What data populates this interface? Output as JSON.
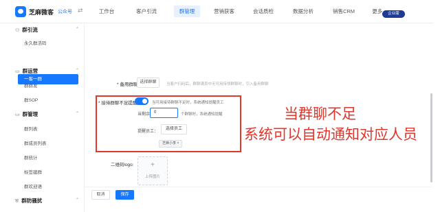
{
  "header": {
    "brand": "芝麻微客",
    "scope": "公众号",
    "nav": [
      "工作台",
      "客户引流",
      "群管理",
      "营销获客",
      "会话质检",
      "数据分析",
      "销售CRM",
      "更多 ⌄"
    ],
    "active_nav": 2,
    "upgrade": "企业版"
  },
  "sidebar": {
    "groups": [
      {
        "label": "群引流",
        "icon": "user-group-icon"
      },
      {
        "label": "群运营",
        "icon": "chat-icon"
      },
      {
        "label": "群管理",
        "icon": "chat-icon"
      },
      {
        "label": "群防骚扰",
        "icon": "shield-icon"
      }
    ],
    "items_g1": [
      "永久群活码"
    ],
    "active_item": "一客一群",
    "items_g2": [
      "群群发",
      "群SOP"
    ],
    "items_g3": [
      "群列表",
      "群成员列表",
      "群统计",
      "标签建群",
      "群欢迎语"
    ]
  },
  "form": {
    "backup_label": "* 备用群聊",
    "backup_button": "选择群聊",
    "backup_hint": "当客户扫码后，群聊满员中无可用待领群聊时，引入备用群聊",
    "remind_label": "* 接待群聊不足提醒",
    "remind_desc": "当可用接待群聊不足时，系统通知提醒员工",
    "cond_prefix": "当剩余",
    "cond_value": "0",
    "cond_suffix": "个群聊时，系统通知提醒",
    "staff_label": "提醒员工：",
    "staff_button": "选择员工",
    "staff_tag": "芝麻小李 ×",
    "qr_label": "二维码logo:",
    "upload_plus": "+",
    "upload_text": "上传图片"
  },
  "annotation": {
    "line1": "当群聊不足",
    "line2": "系统可以自动通知对应人员"
  },
  "footer": {
    "cancel": "取消",
    "save": "保存"
  }
}
